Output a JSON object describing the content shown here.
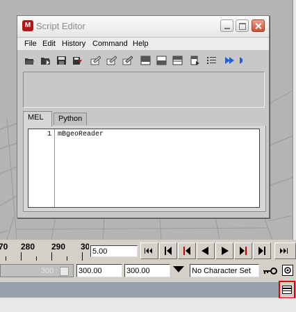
{
  "script_editor": {
    "title": "Script Editor",
    "menu": [
      "File",
      "Edit",
      "History",
      "Command",
      "Help"
    ],
    "toolbar_icons": [
      "open-script-icon",
      "source-script-icon",
      "save-script-icon",
      "save-script-to-shelf-icon",
      "clear-history-icon",
      "clear-input-icon",
      "clear-all-icon",
      "show-history-only-icon",
      "show-input-only-icon",
      "show-both-icon",
      "echo-all-commands-icon",
      "show-line-numbers-icon",
      "execute-all-icon",
      "execute-selected-icon"
    ],
    "tabs": [
      "MEL",
      "Python"
    ],
    "active_tab": "MEL",
    "input": {
      "line_number": "1",
      "code": "mBgeoReader"
    }
  },
  "time_slider": {
    "tick_labels": [
      "70",
      "280",
      "290",
      "30"
    ],
    "current_frame": "5.00",
    "playback_buttons": [
      "go-to-start-icon",
      "step-back-frame-icon",
      "step-back-key-icon",
      "play-backwards-icon",
      "play-forwards-icon",
      "step-forward-key-icon",
      "step-forward-frame-icon",
      "go-to-end-icon"
    ]
  },
  "range_slider": {
    "slider_value": "300",
    "animation_end": "300.00",
    "range_end": "300.00",
    "character_set": "No Character Set"
  },
  "colors": {
    "viewport_bg": "#b4b4b4",
    "command_bar": "#97a0ad",
    "highlight_border": "#e00000"
  }
}
